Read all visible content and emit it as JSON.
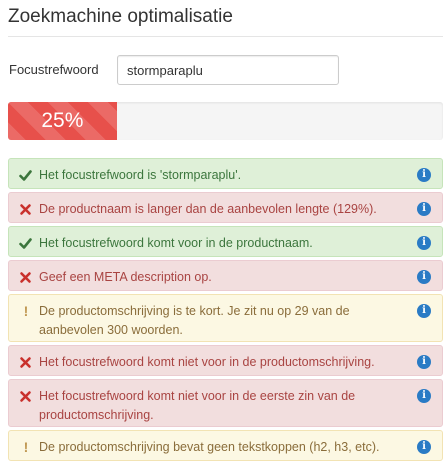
{
  "title": "Zoekmachine optimalisatie",
  "keyword": {
    "label": "Focustrefwoord",
    "value": "stormparaplu"
  },
  "score": {
    "percent": 25,
    "label": "25%",
    "color": "#e7504b"
  },
  "colors": {
    "success": "#3c763d",
    "danger": "#a94442",
    "warning": "#8a6d3b",
    "info_icon": "#2a7bc5"
  },
  "checks": [
    {
      "status": "success",
      "icon": "check-icon",
      "text": "Het focustrefwoord is 'stormparaplu'."
    },
    {
      "status": "danger",
      "icon": "cross-icon",
      "text": "De productnaam is langer dan de aanbevolen lengte (129%)."
    },
    {
      "status": "success",
      "icon": "check-icon",
      "text": "Het focustrefwoord komt voor in de productnaam."
    },
    {
      "status": "danger",
      "icon": "cross-icon",
      "text": "Geef een META description op."
    },
    {
      "status": "warning",
      "icon": "exclamation-icon",
      "text": "De productomschrijving is te kort. Je zit nu op 29 van de aanbevolen 300 woorden."
    },
    {
      "status": "danger",
      "icon": "cross-icon",
      "text": "Het focustrefwoord komt niet voor in de productomschrijving."
    },
    {
      "status": "danger",
      "icon": "cross-icon",
      "text": "Het focustrefwoord komt niet voor in de eerste zin van de productomschrijving."
    },
    {
      "status": "warning",
      "icon": "exclamation-icon",
      "text": "De productomschrijving bevat geen tekstkoppen (h2, h3, etc)."
    }
  ],
  "info_icon_glyph": "i"
}
